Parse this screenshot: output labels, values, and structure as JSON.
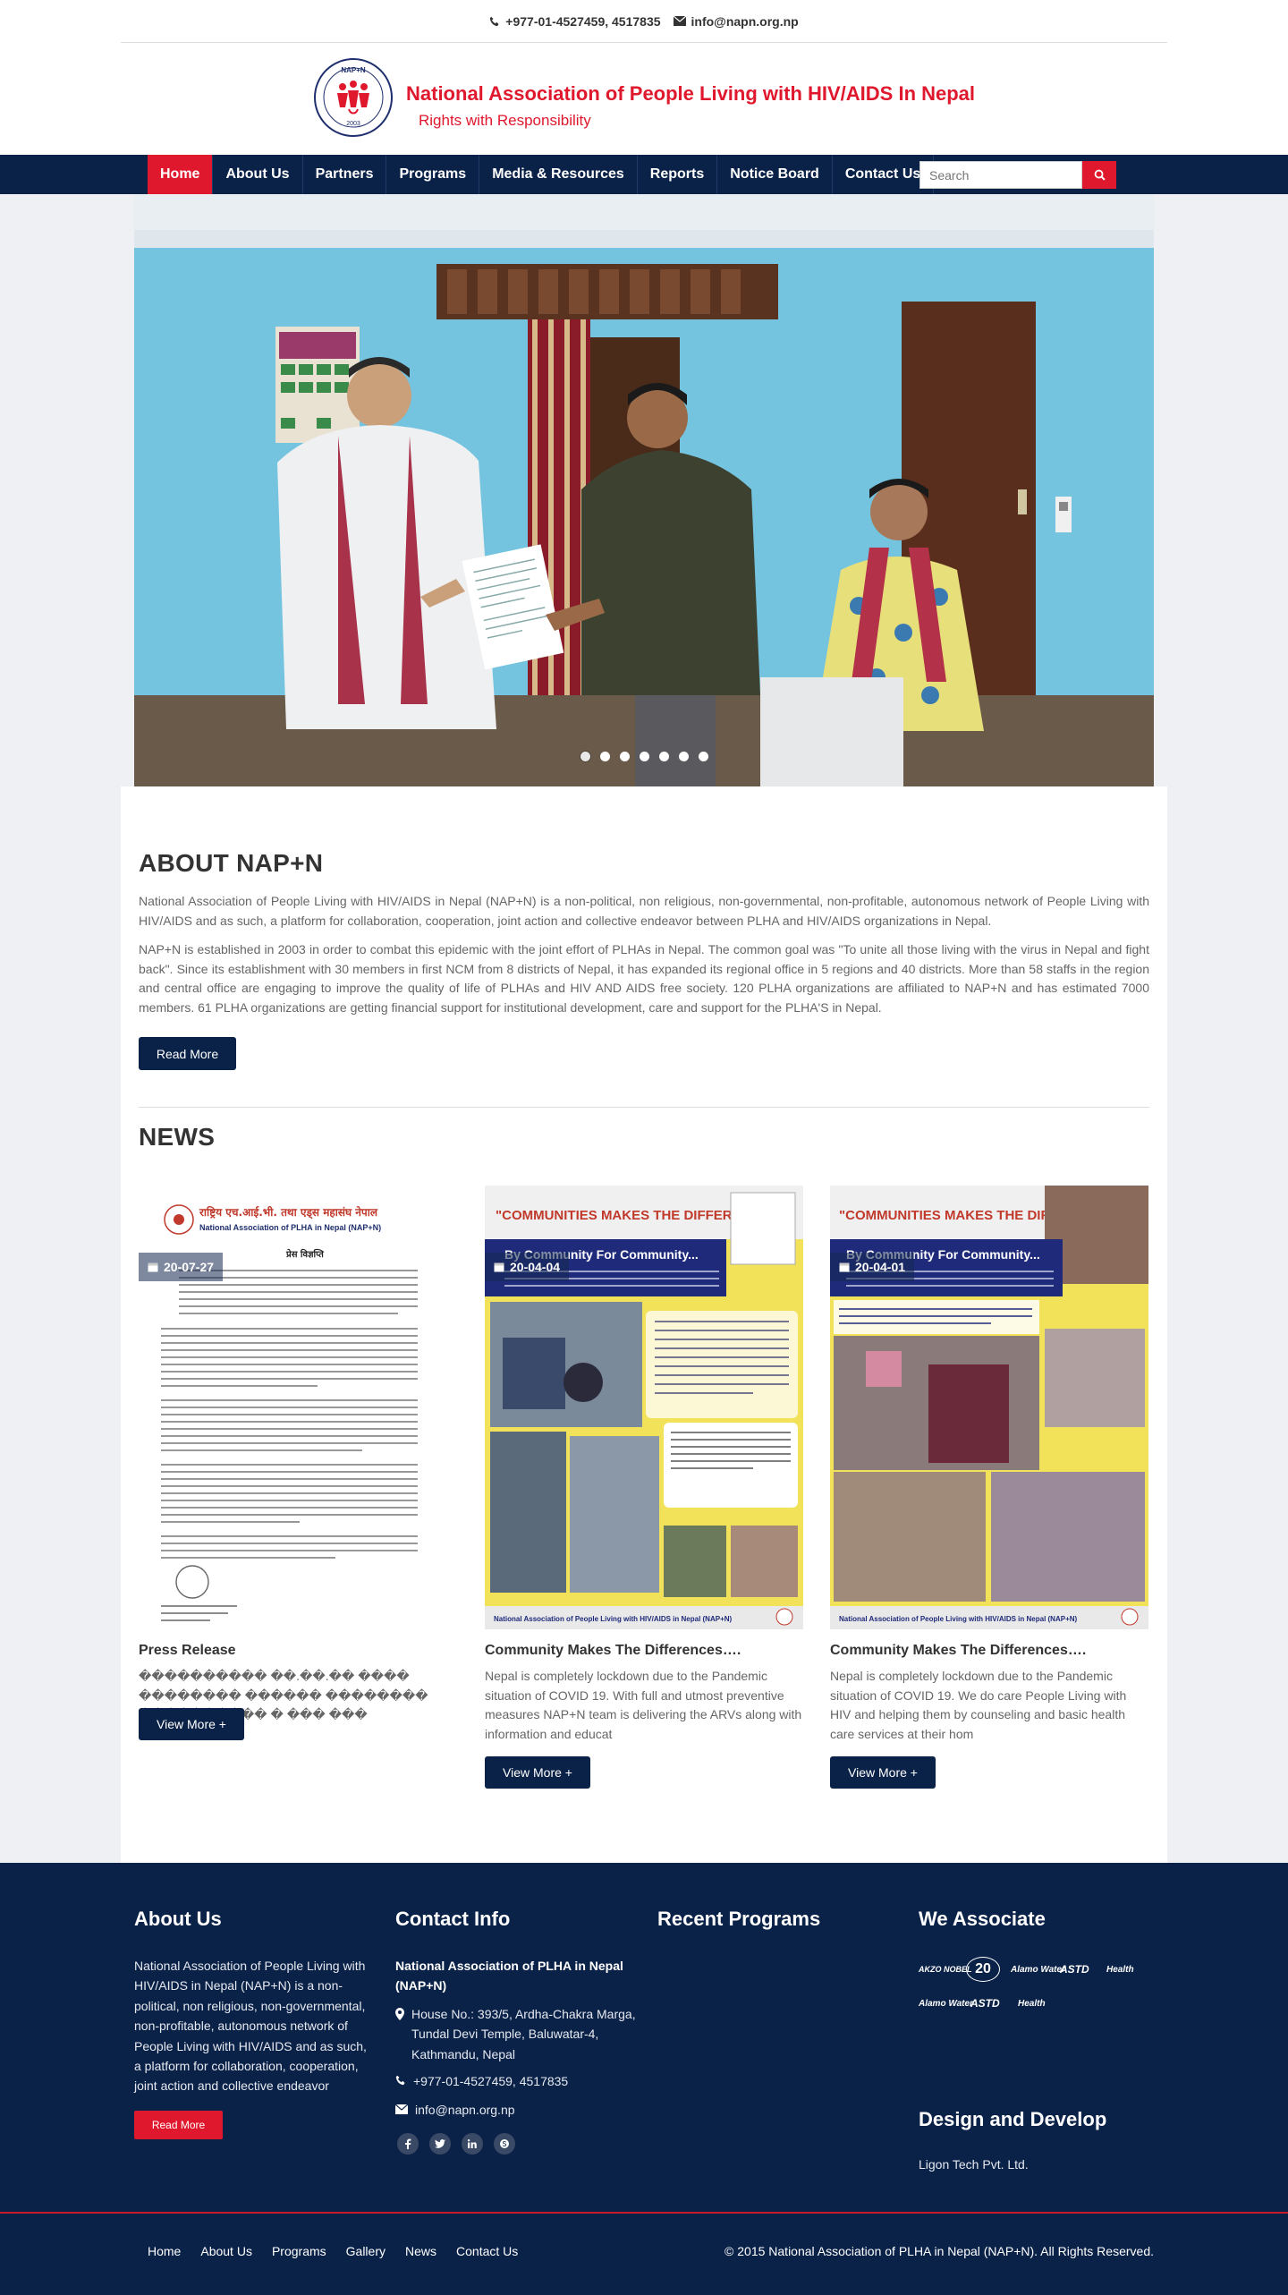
{
  "topbar": {
    "phone": "+977-01-4527459, 4517835",
    "email": "info@napn.org.np"
  },
  "brand": {
    "title": "National Association of People Living with HIV/AIDS In Nepal",
    "subtitle": "Rights with Responsibility",
    "logo_text": "NAP+N",
    "logo_year": "2003"
  },
  "nav": {
    "items": [
      {
        "label": "Home",
        "active": true
      },
      {
        "label": "About Us"
      },
      {
        "label": "Partners"
      },
      {
        "label": "Programs"
      },
      {
        "label": "Media & Resources"
      },
      {
        "label": "Reports"
      },
      {
        "label": "Notice Board"
      },
      {
        "label": "Contact Us"
      }
    ],
    "search_placeholder": "Search"
  },
  "hero": {
    "slide_count": 7,
    "active_slide": 1
  },
  "about": {
    "heading": "ABOUT NAP+N",
    "p1": "National Association of People Living with HIV/AIDS in Nepal (NAP+N) is a non-political, non religious, non-governmental, non-profitable, autonomous network of People Living with HIV/AIDS and as such, a platform for collaboration, cooperation, joint action and collective endeavor between PLHA and HIV/AIDS organizations in Nepal.",
    "p2": "NAP+N is established in 2003 in order to combat this epidemic with the joint effort of PLHAs in Nepal. The common goal was \"To unite all those living with the virus in Nepal and fight back\". Since its establishment with 30 members in first NCM from 8 districts of Nepal, it has expanded its regional office in 5 regions and 40 districts. More than 58 staffs in the region and central office are engaging to improve the quality of life of PLHAs and HIV AND AIDS free society. 120 PLHA organizations are affiliated to NAP+N and has estimated 7000 members. 61 PLHA organizations are getting financial support for institutional development, care and support for the PLHA'S in Nepal.",
    "read_more": "Read More"
  },
  "news": {
    "heading": "NEWS",
    "items": [
      {
        "date": "20-07-27",
        "title": "Press Release",
        "excerpt": "���������� ��.��.�� ���� �������� ������ �������� ���������� � ��� ���",
        "button": "View More +"
      },
      {
        "date": "20-04-04",
        "title": "Community Makes The Differences….",
        "excerpt": "Nepal is completely lockdown due to the Pandemic situation of COVID 19. With full and utmost preventive measures NAP+N team is delivering the ARVs along with information and educat",
        "button": "View More +"
      },
      {
        "date": "20-04-01",
        "title": "Community Makes The Differences….",
        "excerpt": "Nepal is completely lockdown due to the Pandemic situation of COVID 19. We do care People Living with HIV and helping them by counseling and basic health care services at their hom",
        "button": "View More +"
      }
    ],
    "poster": {
      "banner": "\"COMMUNITIES MAKES THE DIFFERENCE\"",
      "tagline": "By Community For Community...",
      "footer": "National Association of People Living with HIV/AIDS in Nepal (NAP+N)"
    },
    "press_doc": {
      "org_name": "राष्ट्रिय एच.आई.भी. तथा एड्स महासंघ नेपाल",
      "org_name_en": "National Association of PLHA in Nepal (NAP+N)",
      "doc_title": "प्रेस विज्ञप्ति"
    }
  },
  "footer": {
    "about": {
      "heading": "About Us",
      "text": "National Association of People Living with HIV/AIDS in Nepal (NAP+N) is a non-political, non religious, non-governmental, non-profitable, autonomous network of People Living with HIV/AIDS and as such, a platform for collaboration, cooperation, joint action and collective endeavor",
      "read_more": "Read More"
    },
    "contact": {
      "heading": "Contact Info",
      "org": "National Association of PLHA in Nepal (NAP+N)",
      "address": "House No.: 393/5, Ardha-Chakra Marga, Tundal Devi Temple, Baluwatar-4, Kathmandu, Nepal",
      "phone": "+977-01-4527459, 4517835",
      "email": "info@napn.org.np"
    },
    "programs": {
      "heading": "Recent Programs"
    },
    "associate": {
      "heading": "We Associate",
      "partners": [
        "AKZO NOBEL",
        "20",
        "Alamo Water",
        "ASTD",
        "Health",
        "Alamo Water",
        "ASTD",
        "Health"
      ]
    },
    "design": {
      "heading": "Design and Develop",
      "company": "Ligon Tech Pvt. Ltd."
    }
  },
  "bottom": {
    "links": [
      "Home",
      "About Us",
      "Programs",
      "Gallery",
      "News",
      "Contact Us"
    ],
    "copyright": "© 2015 National Association of PLHA in Nepal (NAP+N). All Rights Reserved."
  },
  "colors": {
    "navy": "#0b2248",
    "red": "#e0182d",
    "wall": "#74c4df"
  }
}
